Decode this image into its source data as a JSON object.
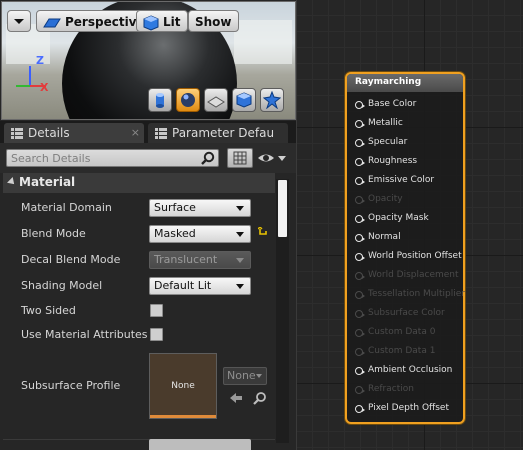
{
  "viewport": {
    "perspective_label": "Perspective",
    "lit_label": "Lit",
    "show_label": "Show",
    "axis_z": "Z",
    "axis_x": "X",
    "preview_shapes": [
      "cylinder-icon",
      "sphere-icon",
      "plane-icon",
      "cube-icon",
      "custom-mesh-icon"
    ],
    "selected_preview": "sphere-icon"
  },
  "tabs": [
    {
      "label": "Details",
      "active": true
    },
    {
      "label": "Parameter Defau",
      "active": false
    }
  ],
  "tab_close": "×",
  "search": {
    "placeholder": "Search Details",
    "value": ""
  },
  "category": {
    "title": "Material"
  },
  "properties": [
    {
      "label": "Material Domain",
      "type": "combo",
      "value": "Surface",
      "enabled": true
    },
    {
      "label": "Blend Mode",
      "type": "combo",
      "value": "Masked",
      "enabled": true,
      "reset": true
    },
    {
      "label": "Decal Blend Mode",
      "type": "combo",
      "value": "Translucent",
      "enabled": false
    },
    {
      "label": "Shading Model",
      "type": "combo",
      "value": "Default Lit",
      "enabled": true
    },
    {
      "label": "Two Sided",
      "type": "checkbox",
      "checked": false
    },
    {
      "label": "Use Material Attributes",
      "type": "checkbox",
      "checked": false
    },
    {
      "label": "Subsurface Profile",
      "type": "asset"
    }
  ],
  "subsurface": {
    "thumb_label": "None",
    "combo_value": "None"
  },
  "node": {
    "title": "Raymarching",
    "accent": "#f0a020",
    "pins": [
      {
        "label": "Base Color",
        "enabled": true
      },
      {
        "label": "Metallic",
        "enabled": true
      },
      {
        "label": "Specular",
        "enabled": true
      },
      {
        "label": "Roughness",
        "enabled": true
      },
      {
        "label": "Emissive Color",
        "enabled": true
      },
      {
        "label": "Opacity",
        "enabled": false
      },
      {
        "label": "Opacity Mask",
        "enabled": true
      },
      {
        "label": "Normal",
        "enabled": true
      },
      {
        "label": "World Position Offset",
        "enabled": true
      },
      {
        "label": "World Displacement",
        "enabled": false
      },
      {
        "label": "Tessellation Multiplier",
        "enabled": false
      },
      {
        "label": "Subsurface Color",
        "enabled": false
      },
      {
        "label": "Custom Data 0",
        "enabled": false
      },
      {
        "label": "Custom Data 1",
        "enabled": false
      },
      {
        "label": "Ambient Occlusion",
        "enabled": true
      },
      {
        "label": "Refraction",
        "enabled": false
      },
      {
        "label": "Pixel Depth Offset",
        "enabled": true
      }
    ]
  }
}
